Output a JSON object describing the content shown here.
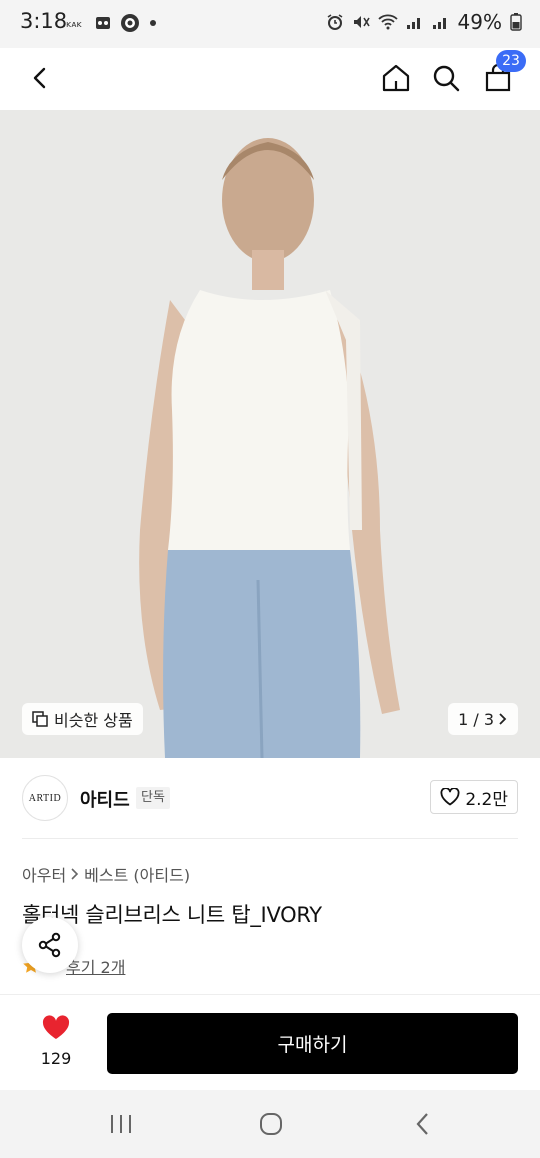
{
  "status_bar": {
    "time": "3:18",
    "battery": "49%"
  },
  "header": {
    "back_icon": "chevron-left-icon",
    "home_icon": "home-icon",
    "search_icon": "search-icon",
    "cart_icon": "shopping-bag-icon",
    "cart_count": "23",
    "badge_color": "#3b6cf6"
  },
  "gallery": {
    "similar_products_label": "비슷한 상품",
    "page_indicator": "1 / 3"
  },
  "brand": {
    "logo_text": "ARTID",
    "name": "아티드",
    "exclusive_badge": "단독",
    "like_count": "2.2만"
  },
  "product": {
    "breadcrumb": [
      "아우터",
      "베스트 (아티드)"
    ],
    "title": "홀터넥 슬리브리스 니트 탑_IVORY",
    "review_label": "후기 2개"
  },
  "purchase": {
    "wish_count": "129",
    "buy_label": "구매하기",
    "heart_color": "#e8242f",
    "button_color": "#000000"
  }
}
